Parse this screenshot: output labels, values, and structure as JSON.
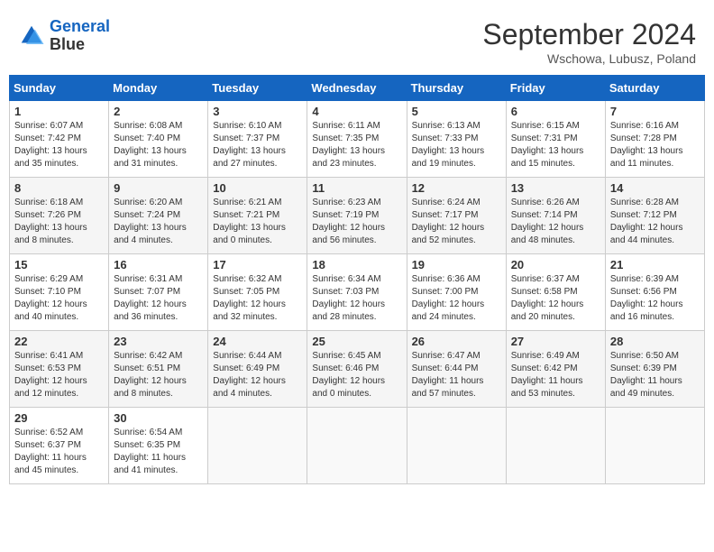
{
  "header": {
    "logo_line1": "General",
    "logo_line2": "Blue",
    "month_year": "September 2024",
    "location": "Wschowa, Lubusz, Poland"
  },
  "days_of_week": [
    "Sunday",
    "Monday",
    "Tuesday",
    "Wednesday",
    "Thursday",
    "Friday",
    "Saturday"
  ],
  "weeks": [
    [
      {
        "day": "1",
        "sunrise": "Sunrise: 6:07 AM",
        "sunset": "Sunset: 7:42 PM",
        "daylight": "Daylight: 13 hours and 35 minutes."
      },
      {
        "day": "2",
        "sunrise": "Sunrise: 6:08 AM",
        "sunset": "Sunset: 7:40 PM",
        "daylight": "Daylight: 13 hours and 31 minutes."
      },
      {
        "day": "3",
        "sunrise": "Sunrise: 6:10 AM",
        "sunset": "Sunset: 7:37 PM",
        "daylight": "Daylight: 13 hours and 27 minutes."
      },
      {
        "day": "4",
        "sunrise": "Sunrise: 6:11 AM",
        "sunset": "Sunset: 7:35 PM",
        "daylight": "Daylight: 13 hours and 23 minutes."
      },
      {
        "day": "5",
        "sunrise": "Sunrise: 6:13 AM",
        "sunset": "Sunset: 7:33 PM",
        "daylight": "Daylight: 13 hours and 19 minutes."
      },
      {
        "day": "6",
        "sunrise": "Sunrise: 6:15 AM",
        "sunset": "Sunset: 7:31 PM",
        "daylight": "Daylight: 13 hours and 15 minutes."
      },
      {
        "day": "7",
        "sunrise": "Sunrise: 6:16 AM",
        "sunset": "Sunset: 7:28 PM",
        "daylight": "Daylight: 13 hours and 11 minutes."
      }
    ],
    [
      {
        "day": "8",
        "sunrise": "Sunrise: 6:18 AM",
        "sunset": "Sunset: 7:26 PM",
        "daylight": "Daylight: 13 hours and 8 minutes."
      },
      {
        "day": "9",
        "sunrise": "Sunrise: 6:20 AM",
        "sunset": "Sunset: 7:24 PM",
        "daylight": "Daylight: 13 hours and 4 minutes."
      },
      {
        "day": "10",
        "sunrise": "Sunrise: 6:21 AM",
        "sunset": "Sunset: 7:21 PM",
        "daylight": "Daylight: 13 hours and 0 minutes."
      },
      {
        "day": "11",
        "sunrise": "Sunrise: 6:23 AM",
        "sunset": "Sunset: 7:19 PM",
        "daylight": "Daylight: 12 hours and 56 minutes."
      },
      {
        "day": "12",
        "sunrise": "Sunrise: 6:24 AM",
        "sunset": "Sunset: 7:17 PM",
        "daylight": "Daylight: 12 hours and 52 minutes."
      },
      {
        "day": "13",
        "sunrise": "Sunrise: 6:26 AM",
        "sunset": "Sunset: 7:14 PM",
        "daylight": "Daylight: 12 hours and 48 minutes."
      },
      {
        "day": "14",
        "sunrise": "Sunrise: 6:28 AM",
        "sunset": "Sunset: 7:12 PM",
        "daylight": "Daylight: 12 hours and 44 minutes."
      }
    ],
    [
      {
        "day": "15",
        "sunrise": "Sunrise: 6:29 AM",
        "sunset": "Sunset: 7:10 PM",
        "daylight": "Daylight: 12 hours and 40 minutes."
      },
      {
        "day": "16",
        "sunrise": "Sunrise: 6:31 AM",
        "sunset": "Sunset: 7:07 PM",
        "daylight": "Daylight: 12 hours and 36 minutes."
      },
      {
        "day": "17",
        "sunrise": "Sunrise: 6:32 AM",
        "sunset": "Sunset: 7:05 PM",
        "daylight": "Daylight: 12 hours and 32 minutes."
      },
      {
        "day": "18",
        "sunrise": "Sunrise: 6:34 AM",
        "sunset": "Sunset: 7:03 PM",
        "daylight": "Daylight: 12 hours and 28 minutes."
      },
      {
        "day": "19",
        "sunrise": "Sunrise: 6:36 AM",
        "sunset": "Sunset: 7:00 PM",
        "daylight": "Daylight: 12 hours and 24 minutes."
      },
      {
        "day": "20",
        "sunrise": "Sunrise: 6:37 AM",
        "sunset": "Sunset: 6:58 PM",
        "daylight": "Daylight: 12 hours and 20 minutes."
      },
      {
        "day": "21",
        "sunrise": "Sunrise: 6:39 AM",
        "sunset": "Sunset: 6:56 PM",
        "daylight": "Daylight: 12 hours and 16 minutes."
      }
    ],
    [
      {
        "day": "22",
        "sunrise": "Sunrise: 6:41 AM",
        "sunset": "Sunset: 6:53 PM",
        "daylight": "Daylight: 12 hours and 12 minutes."
      },
      {
        "day": "23",
        "sunrise": "Sunrise: 6:42 AM",
        "sunset": "Sunset: 6:51 PM",
        "daylight": "Daylight: 12 hours and 8 minutes."
      },
      {
        "day": "24",
        "sunrise": "Sunrise: 6:44 AM",
        "sunset": "Sunset: 6:49 PM",
        "daylight": "Daylight: 12 hours and 4 minutes."
      },
      {
        "day": "25",
        "sunrise": "Sunrise: 6:45 AM",
        "sunset": "Sunset: 6:46 PM",
        "daylight": "Daylight: 12 hours and 0 minutes."
      },
      {
        "day": "26",
        "sunrise": "Sunrise: 6:47 AM",
        "sunset": "Sunset: 6:44 PM",
        "daylight": "Daylight: 11 hours and 57 minutes."
      },
      {
        "day": "27",
        "sunrise": "Sunrise: 6:49 AM",
        "sunset": "Sunset: 6:42 PM",
        "daylight": "Daylight: 11 hours and 53 minutes."
      },
      {
        "day": "28",
        "sunrise": "Sunrise: 6:50 AM",
        "sunset": "Sunset: 6:39 PM",
        "daylight": "Daylight: 11 hours and 49 minutes."
      }
    ],
    [
      {
        "day": "29",
        "sunrise": "Sunrise: 6:52 AM",
        "sunset": "Sunset: 6:37 PM",
        "daylight": "Daylight: 11 hours and 45 minutes."
      },
      {
        "day": "30",
        "sunrise": "Sunrise: 6:54 AM",
        "sunset": "Sunset: 6:35 PM",
        "daylight": "Daylight: 11 hours and 41 minutes."
      },
      null,
      null,
      null,
      null,
      null
    ]
  ]
}
